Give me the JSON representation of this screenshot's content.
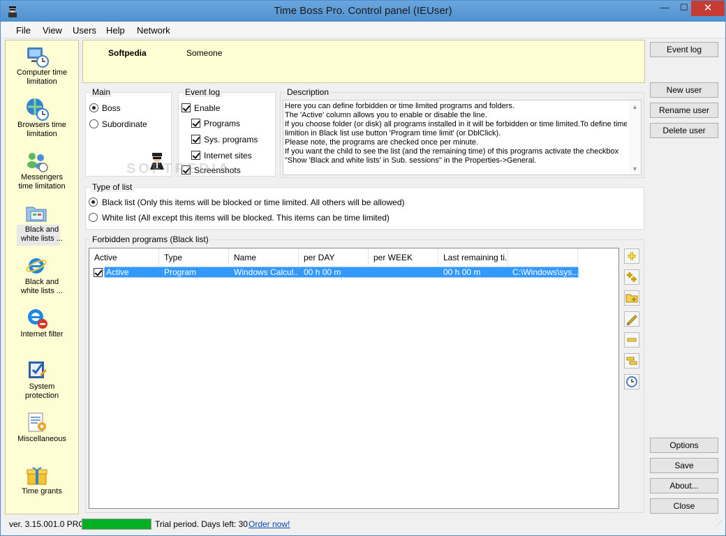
{
  "window": {
    "title": "Time Boss Pro. Control panel (IEUser)",
    "minimize": "—",
    "maximize": "☐",
    "close": "✕"
  },
  "menu": [
    "File",
    "View",
    "Users",
    "Help",
    "Network"
  ],
  "sidebar": {
    "items": [
      {
        "label_lines": [
          "Computer time",
          "limitation"
        ],
        "icon": "computer-clock-icon"
      },
      {
        "label_lines": [
          "Browsers time",
          "limitation"
        ],
        "icon": "browser-clock-icon"
      },
      {
        "label_lines": [
          "Messengers",
          "time limitation"
        ],
        "icon": "messengers-icon"
      },
      {
        "label_lines": [
          "Black and",
          "white lists ..."
        ],
        "icon": "folder-list-icon"
      },
      {
        "label_lines": [
          "Black and",
          "white lists ..."
        ],
        "icon": "internet-explorer-icon"
      },
      {
        "label_lines": [
          "Internet filter"
        ],
        "icon": "internet-filter-icon"
      },
      {
        "label_lines": [
          "System",
          "protection"
        ],
        "icon": "system-protection-icon"
      },
      {
        "label_lines": [
          "Miscellaneous"
        ],
        "icon": "miscellaneous-icon"
      },
      {
        "label_lines": [
          "Time grants"
        ],
        "icon": "gift-icon"
      }
    ],
    "selected_index": 3
  },
  "user": {
    "name": "Softpedia",
    "full_name": "Someone"
  },
  "main_group": {
    "title": "Main",
    "options": [
      "Boss",
      "Subordinate"
    ],
    "selected": "Boss"
  },
  "event_log_group": {
    "title": "Event log",
    "items": [
      {
        "label": "Enable",
        "checked": true
      },
      {
        "label": "Programs",
        "checked": true
      },
      {
        "label": "Sys. programs",
        "checked": true
      },
      {
        "label": "Internet sites",
        "checked": true
      },
      {
        "label": "Screenshots",
        "checked": true
      }
    ]
  },
  "description": {
    "title": "Description",
    "lines": [
      "Here you can define forbidden or time limited programs and folders.",
      "The 'Active' column allows you to enable or disable the line.",
      "If you choose folder (or disk) all programs installed in it will be forbidden or time limited.To define time",
      "limition in Black list use button 'Program time limit' (or DblClick).",
      "Please note, the programs are checked once per minute.",
      "If you want the child to see the list (and the remaining time) of this programs activate the checkbox",
      "\"Show 'Black and white lists' in Sub. sessions\" in the Properties->General."
    ]
  },
  "type_of_list": {
    "title": "Type of list",
    "options": [
      "Black list (Only this items will be blocked or time limited. All others will be allowed)",
      "White list (All except this items will be blocked. This items can be time limited)"
    ],
    "selected": 0
  },
  "forbidden": {
    "title": "Forbidden programs (Black list)",
    "columns": [
      "Active",
      "Type",
      "Name",
      "per DAY",
      "per WEEK",
      "Last remaining ti..."
    ],
    "rows": [
      {
        "checked": true,
        "active": "Active",
        "type": "Program",
        "name": "Windows Calcul...",
        "per_day": "00 h 00 m",
        "per_week": "",
        "last_remaining": "00 h 00 m",
        "path": "C:\\Windows\\sys..."
      }
    ]
  },
  "toolbar_icons": [
    "add-icon",
    "add-multiple-icon",
    "add-folder-icon",
    "edit-pencil-icon",
    "remove-icon",
    "remove-multiple-icon",
    "time-limit-clock-icon"
  ],
  "buttons": {
    "event_log": "Event log",
    "new_user": "New user",
    "rename_user": "Rename user",
    "delete_user": "Delete user",
    "options": "Options",
    "save": "Save",
    "about": "About...",
    "close": "Close"
  },
  "status": {
    "version": "ver. 3.15.001.0 PRO",
    "trial_progress": 1.0,
    "trial_text": "Trial period. Days left: 30",
    "order_link": "Order now!"
  },
  "colors": {
    "accent": "#3399ff",
    "sidebar_bg": "#fffdd4",
    "progress": "#06b025",
    "title_bar": "#5b9bd5"
  },
  "watermark": "SOFTPEDIA"
}
